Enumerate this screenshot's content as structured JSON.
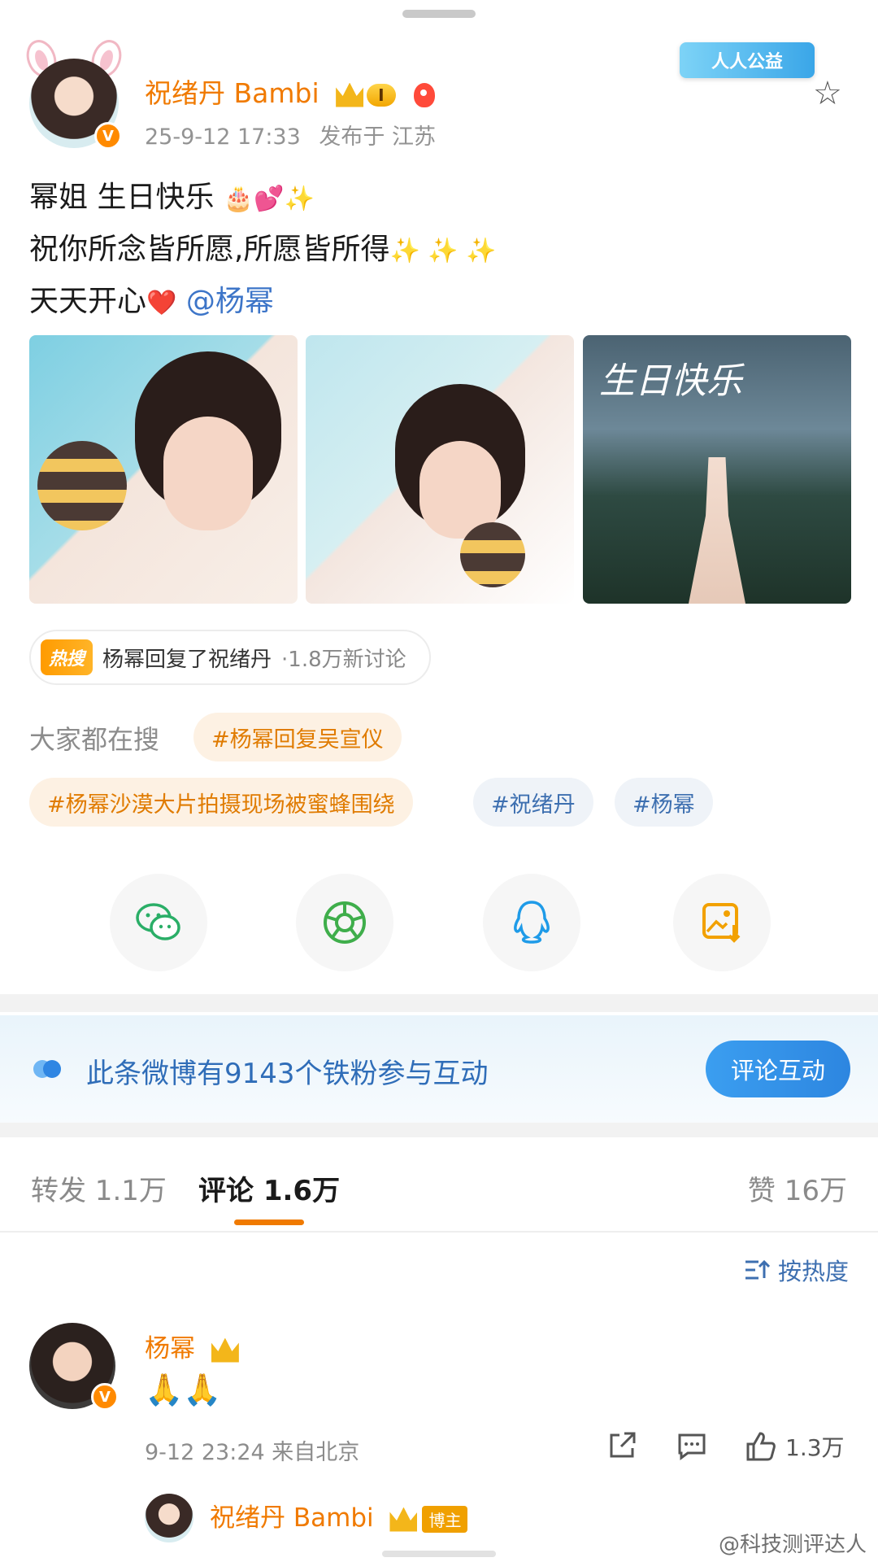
{
  "post": {
    "author": "祝绪丹 Bambi",
    "author_level": "I",
    "timestamp": "25-9-12 17:33",
    "location": "发布于 江苏",
    "charity_badge": "人人公益",
    "text_line1": "幂姐 生日快乐",
    "text_line2": "祝你所念皆所愿,所愿皆所得",
    "text_line3": "天天开心",
    "mention": "@杨幂",
    "emoji1": "🎂💕✨",
    "emoji2": "✨ ✨ ✨",
    "emoji3": "❤️",
    "photo3_title": "生日快乐"
  },
  "hot_search": {
    "tag": "热搜",
    "title": "杨幂回复了祝绪丹",
    "count": "·1.8万新讨论"
  },
  "searching": {
    "label": "大家都在搜",
    "chips": [
      "#杨幂回复吴宣仪",
      "#杨幂沙漠大片拍摄现场被蜜蜂围绕",
      "#祝绪丹",
      "#杨幂"
    ]
  },
  "share_icons": [
    "wechat-icon",
    "moments-icon",
    "qq-icon",
    "save-image-icon"
  ],
  "fans": {
    "text": "此条微博有9143个铁粉参与互动",
    "button": "评论互动"
  },
  "tabs": {
    "repost": "转发 1.1万",
    "comments": "评论 1.6万",
    "likes": "赞 16万"
  },
  "sort": {
    "label": "按热度"
  },
  "comment": {
    "author": "杨幂",
    "body": "🙏🙏",
    "meta": "9-12 23:24 来自北京",
    "likes": "1.3万"
  },
  "reply": {
    "author": "祝绪丹 Bambi",
    "badge": "博主"
  },
  "watermark": "@科技测评达人",
  "colors": {
    "accent": "#f07a00",
    "link": "#3d75c8",
    "fans_button": "#2d86e0"
  }
}
